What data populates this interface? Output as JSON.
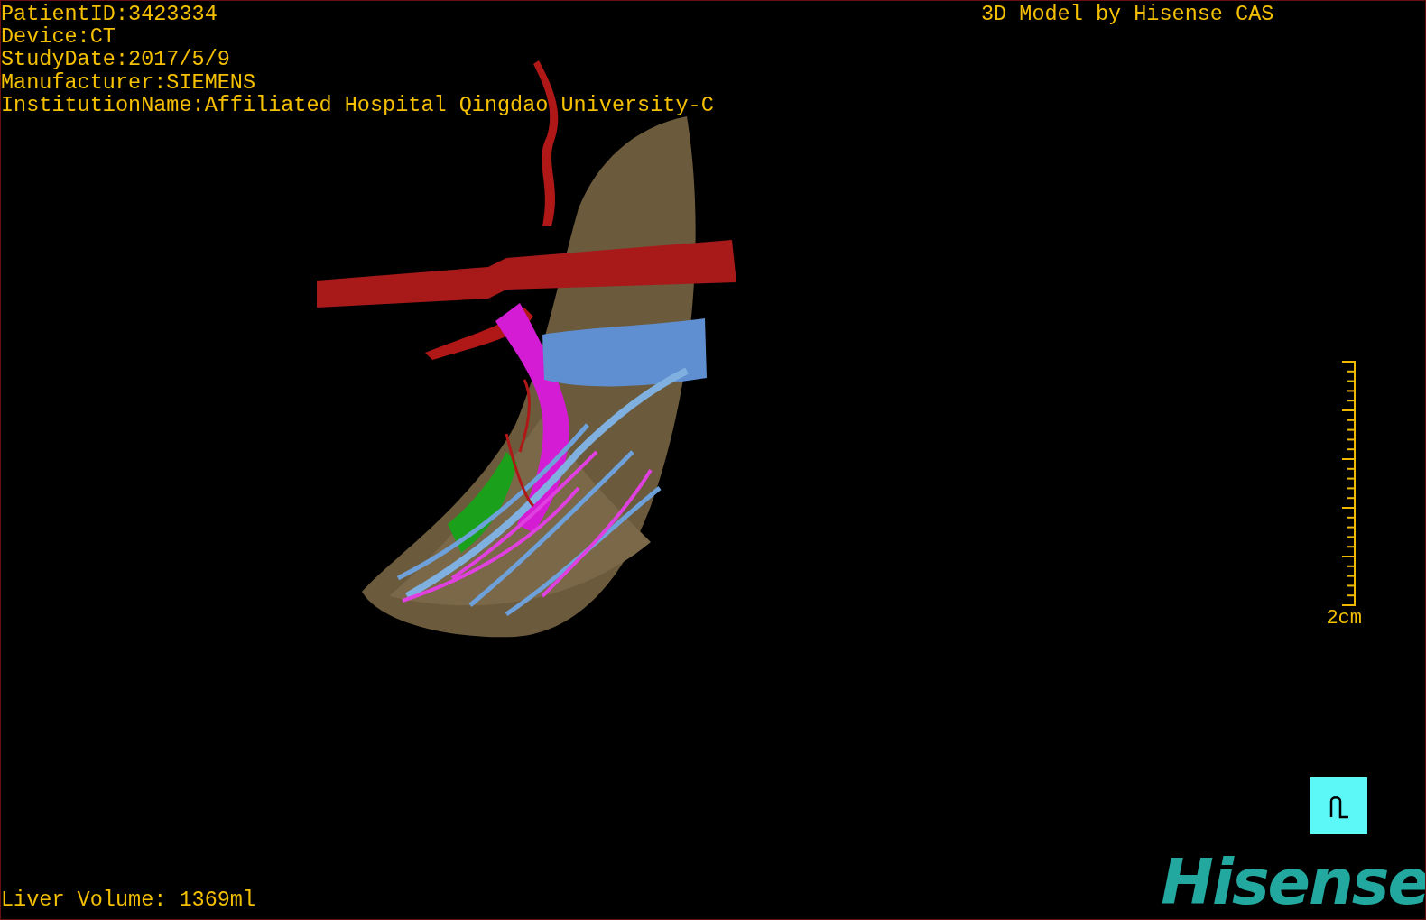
{
  "patient_info": [
    "PatientID:3423334",
    "Device:CT",
    "StudyDate:2017/5/9",
    "Manufacturer:SIEMENS",
    "InstitutionName:Affiliated Hospital Qingdao University-C"
  ],
  "model_credit": "3D Model by Hisense CAS",
  "scale_bar": {
    "label": "2cm"
  },
  "liver_volume": "Liver Volume: 1369ml",
  "logo": "Hisense"
}
